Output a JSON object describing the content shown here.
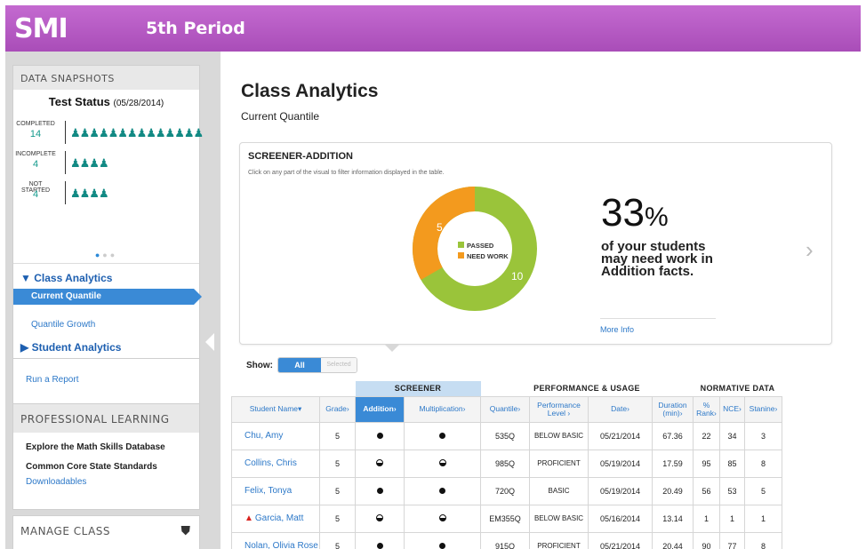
{
  "header": {
    "logo": "SMI",
    "period": "5th Period"
  },
  "sidebar": {
    "snapshots_heading": "DATA SNAPSHOTS",
    "test_status_title": "Test Status",
    "test_status_date": "(05/28/2014)",
    "stats": [
      {
        "label": "COMPLETED",
        "value": "14",
        "icons": "♟♟♟♟♟♟♟♟♟♟♟♟♟♟"
      },
      {
        "label": "INCOMPLETE",
        "value": "4",
        "icons": "♟♟♟♟"
      },
      {
        "label": "NOT STARTED",
        "value": "4",
        "icons": "♟♟♟♟"
      }
    ],
    "nav": {
      "class_analytics": "Class Analytics",
      "current_quantile": "Current Quantile",
      "quantile_growth": "Quantile Growth",
      "student_analytics": "Student Analytics",
      "run_report": "Run a Report"
    },
    "professional": {
      "heading": "PROFESSIONAL LEARNING",
      "items": [
        "Explore the Math Skills Database",
        "Common Core State Standards"
      ],
      "link": "Downloadables"
    },
    "manage_heading": "MANAGE CLASS"
  },
  "main": {
    "title": "Class Analytics",
    "subtitle": "Current Quantile",
    "card": {
      "title": "SCREENER-ADDITION",
      "note": "Click on any part of the visual to filter information displayed in the table.",
      "legend_passed": "PASSED",
      "legend_need": "NEED WORK",
      "passed_count": "10",
      "need_count": "5",
      "pct_number": "33",
      "pct_symbol": "%",
      "pct_text": "of your students may need work in Addition facts.",
      "more_info": "More Info"
    },
    "show_label": "Show:",
    "toggle_all": "All",
    "toggle_selected": "Selected",
    "groups": {
      "screener": "SCREENER",
      "performance": "PERFORMANCE & USAGE",
      "normative": "NORMATIVE DATA"
    },
    "columns": [
      "Student Name",
      "Grade",
      "Addition",
      "Multiplication",
      "Quantile",
      "Performance Level",
      "Date",
      "Duration (min)",
      "% Rank",
      "NCE",
      "Stanine"
    ],
    "rows": [
      {
        "name": "Chu, Amy",
        "grade": "5",
        "add": "full",
        "mult": "full",
        "quantile": "535Q",
        "level": "BELOW BASIC",
        "date": "05/21/2014",
        "duration": "67.36",
        "rank": "22",
        "nce": "34",
        "stanine": "3",
        "warn": false
      },
      {
        "name": "Collins, Chris",
        "grade": "5",
        "add": "half",
        "mult": "half",
        "quantile": "985Q",
        "level": "PROFICIENT",
        "date": "05/19/2014",
        "duration": "17.59",
        "rank": "95",
        "nce": "85",
        "stanine": "8",
        "warn": false
      },
      {
        "name": "Felix, Tonya",
        "grade": "5",
        "add": "full",
        "mult": "full",
        "quantile": "720Q",
        "level": "BASIC",
        "date": "05/19/2014",
        "duration": "20.49",
        "rank": "56",
        "nce": "53",
        "stanine": "5",
        "warn": false
      },
      {
        "name": "Garcia, Matt",
        "grade": "5",
        "add": "half",
        "mult": "half",
        "quantile": "EM355Q",
        "level": "BELOW BASIC",
        "date": "05/16/2014",
        "duration": "13.14",
        "rank": "1",
        "nce": "1",
        "stanine": "1",
        "warn": true
      },
      {
        "name": "Nolan, Olivia Rose",
        "grade": "5",
        "add": "full",
        "mult": "full",
        "quantile": "915Q",
        "level": "PROFICIENT",
        "date": "05/21/2014",
        "duration": "20.44",
        "rank": "90",
        "nce": "77",
        "stanine": "8",
        "warn": false
      }
    ]
  },
  "colors": {
    "header": "#b55bc4",
    "accent": "#3a8ad6",
    "passed": "#9ac43a",
    "need_work": "#f39a1e",
    "teal": "#149a8c"
  }
}
